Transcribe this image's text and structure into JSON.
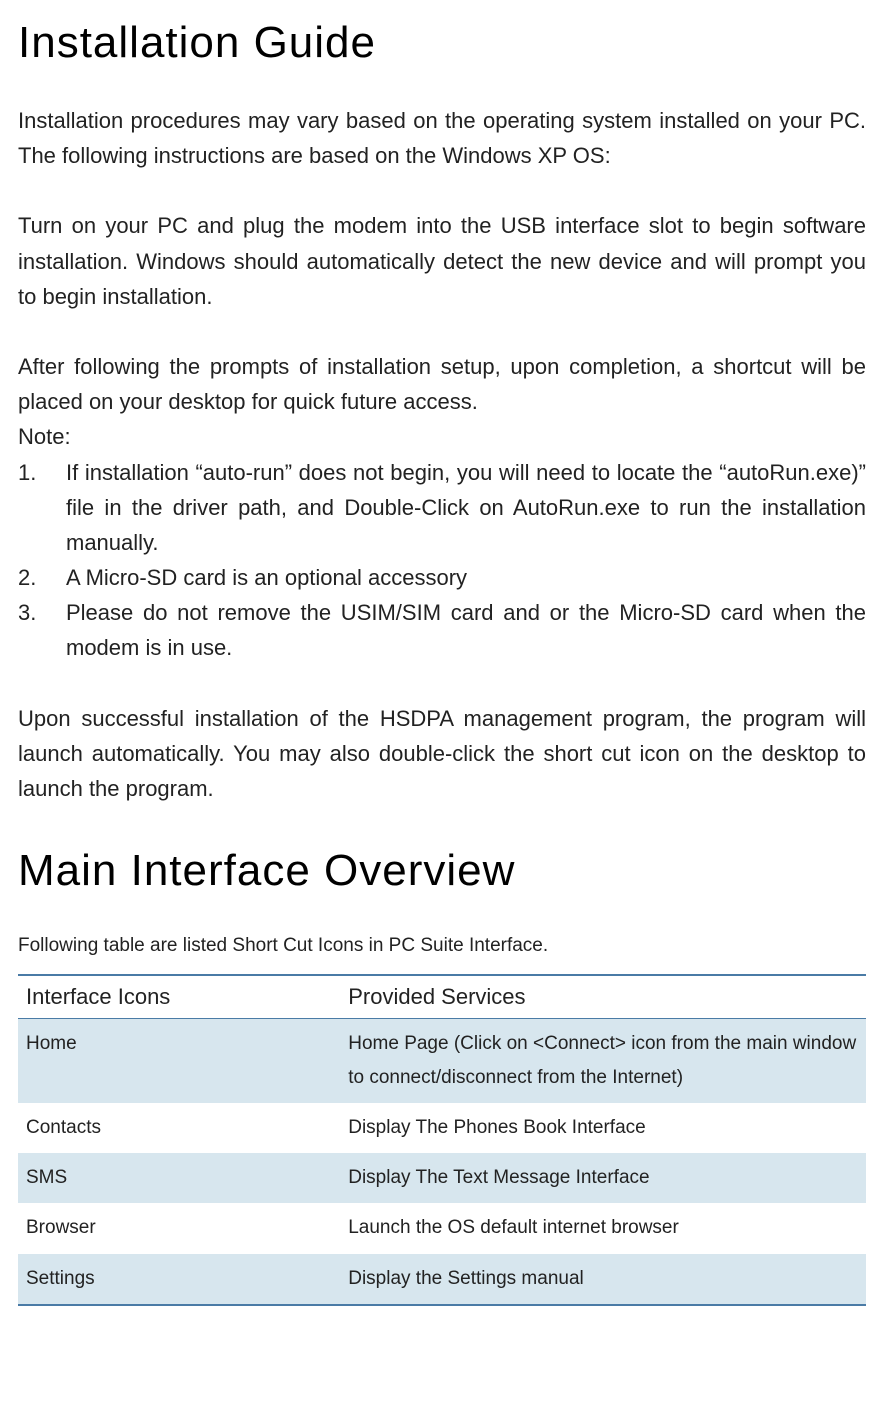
{
  "section1": {
    "title": "Installation Guide",
    "para1": "Installation procedures may vary based on the operating system installed on your PC. The following instructions are based on the Windows XP OS:",
    "para2": "Turn on your PC and plug the modem into the USB interface slot to begin software installation. Windows should automatically detect the new device and will prompt you to begin installation.",
    "para3": "After following the prompts of installation setup, upon completion, a shortcut will be placed on your desktop for quick future access.",
    "noteLabel": "Note:",
    "notes": [
      "If installation “auto-run” does not begin, you will need to locate the “autoRun.exe)” file in the driver path, and Double-Click on AutoRun.exe to run the installation manually.",
      "A Micro-SD card is an optional accessory",
      "Please do not remove the USIM/SIM card and or the Micro-SD card when the modem is in use."
    ],
    "para4": "Upon successful installation of the HSDPA management program, the program will launch automatically. You may also double-click the short cut icon on the desktop to launch the program."
  },
  "section2": {
    "title": "Main Interface Overview",
    "intro": "Following table are listed Short Cut Icons in PC Suite Interface.",
    "headers": [
      "Interface Icons",
      "Provided Services"
    ],
    "rows": [
      {
        "icon": "Home",
        "service": "Home Page (Click on <Connect> icon from the main window to connect/disconnect from the Internet)"
      },
      {
        "icon": "Contacts",
        "service": "Display The Phones Book Interface"
      },
      {
        "icon": "SMS",
        "service": "Display The Text Message Interface"
      },
      {
        "icon": "Browser",
        "service": "Launch the OS default internet browser"
      },
      {
        "icon": "Settings",
        "service": "Display the Settings manual"
      }
    ]
  }
}
